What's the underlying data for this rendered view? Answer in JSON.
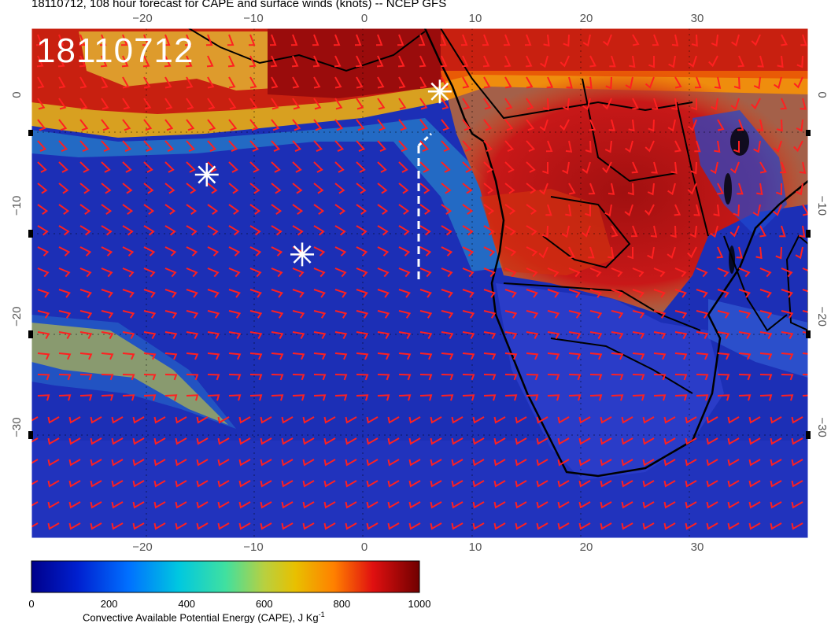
{
  "title": "18110712, 108 hour forecast for CAPE and surface winds (knots) -- NCEP GFS",
  "stamp": "18110712",
  "lon_ticks": [
    "−20",
    "−10",
    "0",
    "10",
    "20",
    "30"
  ],
  "lat_ticks": [
    "0",
    "−10",
    "−20",
    "−30"
  ],
  "colorbar": {
    "ticks": [
      "0",
      "200",
      "400",
      "600",
      "800",
      "1000"
    ],
    "label": "Convective Available Potential Energy (CAPE), J Kg",
    "label_sup": "-1"
  },
  "colors": {
    "low": "#1a2fb8",
    "high": "#8b0000",
    "wind_barb": "#ff2020",
    "marker": "#ffffff"
  },
  "map": {
    "lon_range": [
      -30,
      40
    ],
    "lat_range": [
      -40,
      6
    ],
    "markers": [
      {
        "name": "marker-1",
        "lon": 6.8,
        "lat": 0.3
      },
      {
        "name": "marker-2",
        "lon": -14.2,
        "lat": -7.2
      },
      {
        "name": "marker-3",
        "lon": -5.6,
        "lat": -14.4
      }
    ]
  }
}
